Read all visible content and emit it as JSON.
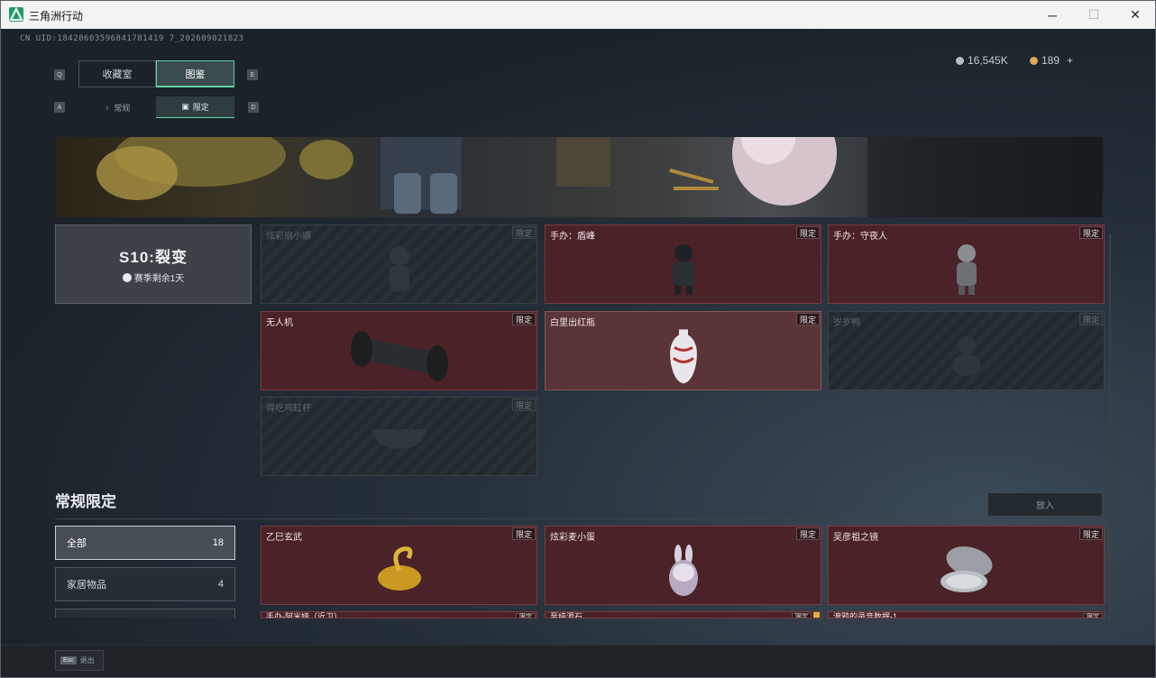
{
  "window": {
    "title": "三角洲行动"
  },
  "header": {
    "uid": "CN UID:18420603596841781419 7_202609021823",
    "currency": [
      {
        "icon": "silver-coin-icon",
        "value": "16,545K",
        "color": "#b8bec3"
      },
      {
        "icon": "gold-coin-icon",
        "value": "189",
        "add": "+",
        "color": "#d9a85a"
      }
    ]
  },
  "tabs": {
    "left_key": "Q",
    "right_key": "E",
    "items": [
      {
        "label": "收藏室"
      },
      {
        "label": "图鉴",
        "active": true
      }
    ]
  },
  "subtabs": {
    "left_key": "A",
    "right_key": "D",
    "items": [
      {
        "label": "常规"
      },
      {
        "label": "限定",
        "active": true
      }
    ]
  },
  "season": {
    "title": "S10:裂变",
    "remaining": "赛季剩余1天"
  },
  "season_items": [
    {
      "name": "炫彩扇小娜",
      "badge": "限定",
      "state": "locked"
    },
    {
      "name": "手办：盾峰",
      "badge": "限定",
      "state": "owned"
    },
    {
      "name": "手办：守夜人",
      "badge": "限定",
      "state": "owned"
    },
    {
      "name": "无人机",
      "badge": "限定",
      "state": "owned"
    },
    {
      "name": "白里出红瓶",
      "badge": "限定",
      "state": "owned-light"
    },
    {
      "name": "岁岁鸭",
      "badge": "限定",
      "state": "locked"
    },
    {
      "name": "得吃鸡缸杯",
      "badge": "限定",
      "state": "locked"
    }
  ],
  "regular": {
    "title": "常规限定",
    "put_button": "放入",
    "categories": [
      {
        "label": "全部",
        "count": "18",
        "active": true
      },
      {
        "label": "家居物品",
        "count": "4"
      }
    ],
    "items": [
      {
        "name": "乙巳玄武",
        "badge": "限定",
        "state": "owned"
      },
      {
        "name": "炫彩麦小蛋",
        "badge": "限定",
        "state": "owned"
      },
      {
        "name": "吴彦祖之镜",
        "badge": "限定",
        "state": "owned"
      },
      {
        "name": "手办-阿米娅（近卫）",
        "badge": "限定",
        "state": "owned"
      },
      {
        "name": "至纯源石",
        "badge": "限定",
        "state": "owned"
      },
      {
        "name": "渡鸦的录音数据-1",
        "badge": "限定",
        "state": "owned"
      }
    ]
  },
  "footer": {
    "esc_key": "Esc",
    "esc_label": "退出"
  }
}
